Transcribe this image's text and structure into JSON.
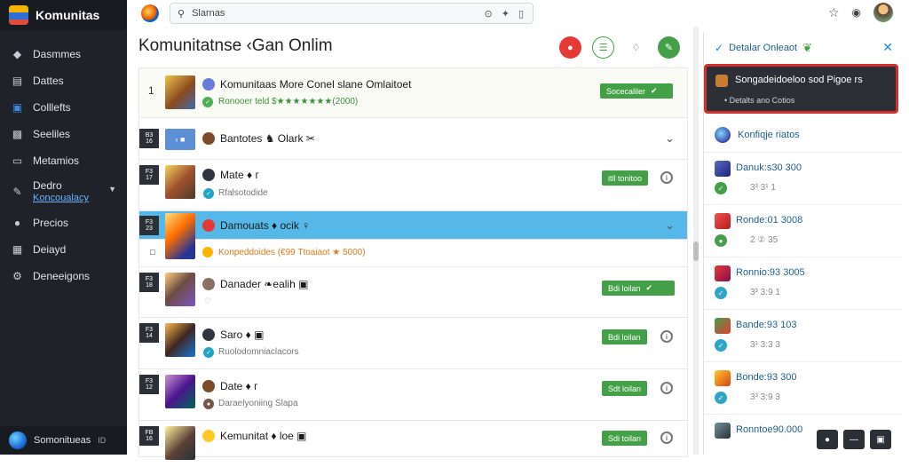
{
  "app": {
    "name": "Komunitas"
  },
  "sidebar": {
    "items": [
      {
        "label": "Dasmmes",
        "icon": "puzzle-icon"
      },
      {
        "label": "Dattes",
        "icon": "document-icon"
      },
      {
        "label": "Colllefts",
        "icon": "collection-icon"
      },
      {
        "label": "Seeliles",
        "icon": "chart-icon"
      },
      {
        "label": "Metamios",
        "icon": "inbox-icon"
      },
      {
        "label": "Dedro",
        "sub": "Koncoualacy",
        "icon": "wrench-icon"
      },
      {
        "label": "Precios",
        "icon": "people-icon"
      },
      {
        "label": "Deiayd",
        "icon": "image-icon"
      },
      {
        "label": "Deneeigons",
        "icon": "gear-icon"
      }
    ],
    "bottom": {
      "label": "Somonitueas",
      "suffix": "ID"
    }
  },
  "topbar": {
    "search_value": "Slarnas"
  },
  "main": {
    "title": "Komunitatnse ‹Gan Onlim",
    "rows": [
      {
        "rank": "1",
        "name": "Komunitaas More Conel slane Omlaitoet",
        "sub": "Ronooer teld $★★★★★★★(2000)",
        "badge": "Socecaliler",
        "badge_icon": "✔"
      },
      {
        "rank_top": "B3",
        "rank_bot": "16",
        "name": "Bantotes ♞ Olark ✂",
        "tag": "‹ ■"
      },
      {
        "rank_top": "F3",
        "rank_bot": "17",
        "name": "Mate ♦ г",
        "sub": "Rfalsotodide",
        "badge": "itll tonitoo"
      },
      {
        "rank_top": "F3",
        "rank_bot": "23",
        "name": "Damouats ♦ ocik ♀",
        "sub": "Konpeddoides (€99 Ttoaiaot ★ 5000)"
      },
      {
        "rank_top": "F3",
        "rank_bot": "18",
        "name": "Danader ❧ealih ▣",
        "badge": "Bdi loilan",
        "badge_icon": "✔"
      },
      {
        "rank_top": "F3",
        "rank_bot": "14",
        "name": "Saro ♦ ▣",
        "sub": "Ruolodomniaclacors",
        "badge": "Bdi loilan"
      },
      {
        "rank_top": "F3",
        "rank_bot": "12",
        "name": "Date ♦ г",
        "sub": "Daraelyoniing Slapa",
        "badge": "Sdt loilan"
      },
      {
        "rank_top": "FB",
        "rank_bot": "16",
        "name": "Kemunitat ♦ loe ▣",
        "badge": "Sdi toilan"
      }
    ]
  },
  "rpanel": {
    "title": "Detalar Onleaot",
    "alert": {
      "title": "Songadeidoeloo sod Pigoe rs",
      "sub": "Detalts ano Cotios"
    },
    "section": "Konfiqje riatos",
    "items": [
      {
        "name": "Danuk:s30 300",
        "value": "3³ 3¹ 1"
      },
      {
        "name": "Ronde:01 3008",
        "value": "2 ② 35"
      },
      {
        "name": "Ronnio:93 3005",
        "value": "3³ 3:9 1"
      },
      {
        "name": "Bande:93 103",
        "value": "3¹ 3:3 3"
      },
      {
        "name": "Bonde:93 300",
        "value": "3³ 3:9 3"
      },
      {
        "name": "Ronntoe90.000",
        "value": ""
      }
    ]
  },
  "colors": {
    "accent": "#43a047",
    "selected": "#56b8e8",
    "alert_border": "#d32f2f",
    "sidebar": "#1f2329"
  }
}
